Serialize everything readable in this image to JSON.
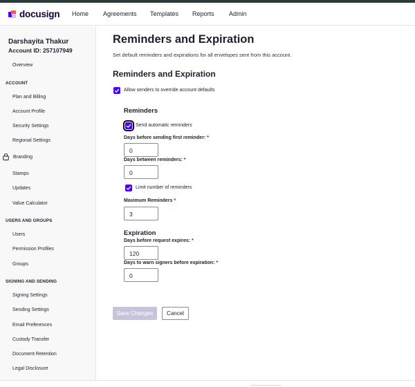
{
  "brand": {
    "name": "docusign"
  },
  "nav": {
    "home": "Home",
    "agreements": "Agreements",
    "templates": "Templates",
    "reports": "Reports",
    "admin": "Admin"
  },
  "account": {
    "name": "Darshayita Thakur",
    "id_label": "Account ID: 257107949"
  },
  "sidebar": {
    "overview": "Overview",
    "account_heading": "ACCOUNT",
    "account_items": [
      "Plan and Billing",
      "Account Profile",
      "Security Settings",
      "Regional Settings",
      "Branding",
      "Stamps",
      "Updates",
      "Value Calculator"
    ],
    "users_heading": "USERS AND GROUPS",
    "users_items": [
      "Users",
      "Permission Profiles",
      "Groups"
    ],
    "signing_heading": "SIGNING AND SENDING",
    "signing_items": [
      "Signing Settings",
      "Sending Settings",
      "Email Preferences",
      "Custody Transfer",
      "Document Retention",
      "Legal Disclosure"
    ]
  },
  "main": {
    "title": "Reminders and Expiration",
    "subtitle": "Set default reminders and expirations for all envelopes sent from this account.",
    "section_title": "Reminders and Expiration",
    "allow_override": {
      "label": "Allow senders to override account defaults",
      "checked": true
    },
    "reminders": {
      "title": "Reminders",
      "send_auto": {
        "label": "Send automatic reminders",
        "checked": true
      },
      "days_first_label": "Days before sending first reminder:",
      "days_first_value": "0",
      "days_between_label": "Days between reminders:",
      "days_between_value": "0",
      "limit": {
        "label": "Limit number of reminders",
        "checked": true
      },
      "max_label": "Maximum Reminders",
      "max_value": "3"
    },
    "expiration": {
      "title": "Expiration",
      "expires_label": "Days before request expires:",
      "expires_value": "120",
      "warn_label": "Days to warn signers before expiration:",
      "warn_value": "0"
    },
    "required_mark": "*",
    "save_label": "Save Changes",
    "cancel_label": "Cancel"
  },
  "colors": {
    "accent": "#4c00ff",
    "top_strip": "#2b3a3c",
    "required": "#cc0000",
    "disabled_button": "#c9c3d9"
  }
}
